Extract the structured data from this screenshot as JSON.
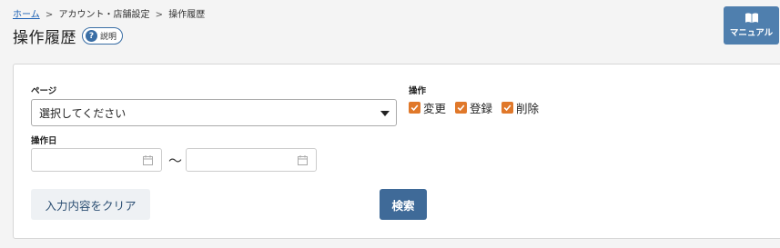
{
  "breadcrumb": {
    "home": "ホーム",
    "separator": ">",
    "section": "アカウント・店舗設定",
    "current": "操作履歴"
  },
  "header": {
    "title": "操作履歴",
    "help_icon": "?",
    "help_label": "説明",
    "manual_label": "マニュアル",
    "manual_icon": "book-icon"
  },
  "form": {
    "page_label": "ページ",
    "page_select_value": "選択してください",
    "operation_label": "操作",
    "operations": [
      {
        "label": "変更",
        "checked": true
      },
      {
        "label": "登録",
        "checked": true
      },
      {
        "label": "削除",
        "checked": true
      }
    ],
    "date_label": "操作日",
    "date_from": "",
    "date_to": "",
    "date_separator": "〜",
    "clear_label": "入力内容をクリア",
    "search_label": "検索"
  },
  "colors": {
    "accent": "#3f6a98",
    "checkbox": "#e0782a",
    "link": "#1a5fb4"
  }
}
